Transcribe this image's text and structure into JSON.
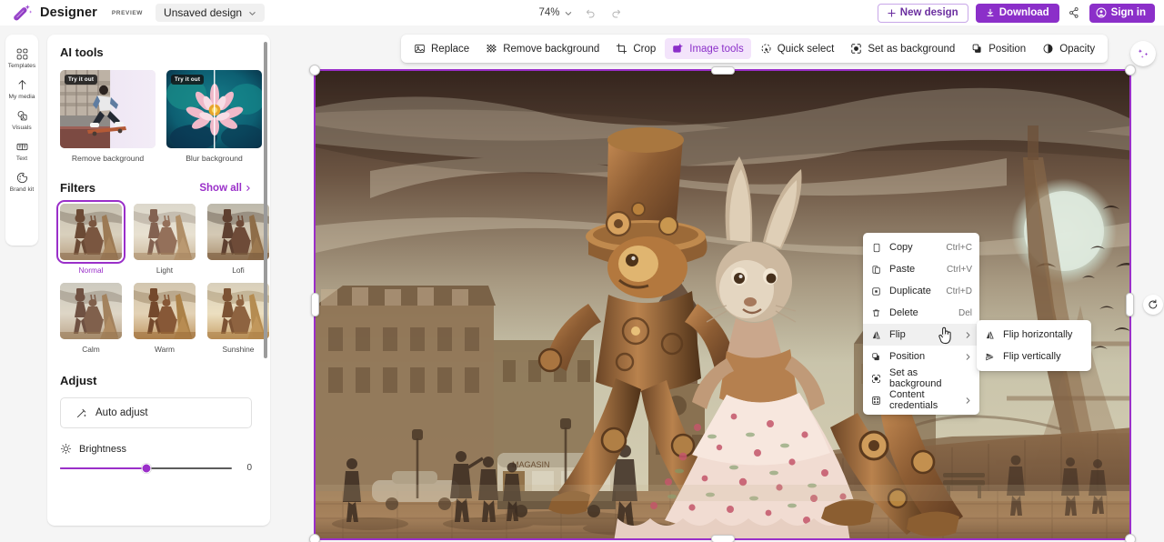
{
  "topbar": {
    "app_name": "Designer",
    "preview_badge": "PREVIEW",
    "doc_title": "Unsaved design",
    "zoom_level": "74%",
    "undo_icon": "undo-icon",
    "redo_icon": "redo-icon",
    "new_design_label": "New design",
    "download_label": "Download",
    "signin_label": "Sign in",
    "share_icon": "share-link-icon",
    "accent": "#8b2fc9"
  },
  "rail": {
    "items": [
      {
        "label": "Templates",
        "icon": "templates-icon"
      },
      {
        "label": "My media",
        "icon": "upload-icon"
      },
      {
        "label": "Visuals",
        "icon": "visuals-icon"
      },
      {
        "label": "Text",
        "icon": "text-icon"
      },
      {
        "label": "Brand kit",
        "icon": "brand-kit-icon"
      }
    ]
  },
  "panel": {
    "ai_tools": {
      "heading": "AI tools",
      "cards": [
        {
          "caption": "Remove background",
          "badge": "Try it out"
        },
        {
          "caption": "Blur background",
          "badge": "Try it out"
        }
      ]
    },
    "filters": {
      "heading": "Filters",
      "show_all": "Show all",
      "selected": "Normal",
      "items": [
        {
          "label": "Normal"
        },
        {
          "label": "Light"
        },
        {
          "label": "Lofi"
        },
        {
          "label": "Calm"
        },
        {
          "label": "Warm"
        },
        {
          "label": "Sunshine"
        }
      ]
    },
    "adjust": {
      "heading": "Adjust",
      "auto_adjust": "Auto adjust",
      "sliders": [
        {
          "label": "Brightness",
          "value": "0",
          "icon": "brightness-icon"
        }
      ]
    }
  },
  "image_toolbar": {
    "items": [
      {
        "label": "Replace",
        "icon": "image-icon",
        "active": false
      },
      {
        "label": "Remove background",
        "icon": "remove-bg-icon",
        "active": false
      },
      {
        "label": "Crop",
        "icon": "crop-icon",
        "active": false
      },
      {
        "label": "Image tools",
        "icon": "image-tools-icon",
        "active": true
      },
      {
        "label": "Quick select",
        "icon": "quick-select-icon",
        "active": false
      },
      {
        "label": "Set as background",
        "icon": "set-bg-icon",
        "active": false
      },
      {
        "label": "Position",
        "icon": "position-icon",
        "active": false
      },
      {
        "label": "Opacity",
        "icon": "opacity-icon",
        "active": false
      }
    ]
  },
  "canvas": {
    "selection_color": "#9a2fc9",
    "rotate_icon": "rotate-icon",
    "magic_fab_icon": "magic-wand-icon"
  },
  "context_menu": {
    "items": [
      {
        "label": "Copy",
        "shortcut": "Ctrl+C",
        "icon": "copy-icon",
        "submenu": false,
        "highlighted": false
      },
      {
        "label": "Paste",
        "shortcut": "Ctrl+V",
        "icon": "paste-icon",
        "submenu": false,
        "highlighted": false
      },
      {
        "label": "Duplicate",
        "shortcut": "Ctrl+D",
        "icon": "duplicate-icon",
        "submenu": false,
        "highlighted": false
      },
      {
        "label": "Delete",
        "shortcut": "Del",
        "icon": "trash-icon",
        "submenu": false,
        "highlighted": false
      },
      {
        "label": "Flip",
        "shortcut": "",
        "icon": "flip-icon",
        "submenu": true,
        "highlighted": true
      },
      {
        "label": "Position",
        "shortcut": "",
        "icon": "position-icon",
        "submenu": true,
        "highlighted": false
      },
      {
        "label": "Set as background",
        "shortcut": "",
        "icon": "set-bg-icon",
        "submenu": false,
        "highlighted": false
      },
      {
        "label": "Content credentials",
        "shortcut": "",
        "icon": "credentials-icon",
        "submenu": true,
        "highlighted": false
      }
    ]
  },
  "submenu": {
    "items": [
      {
        "label": "Flip horizontally",
        "icon": "flip-horizontal-icon"
      },
      {
        "label": "Flip vertically",
        "icon": "flip-vertical-icon"
      }
    ]
  }
}
